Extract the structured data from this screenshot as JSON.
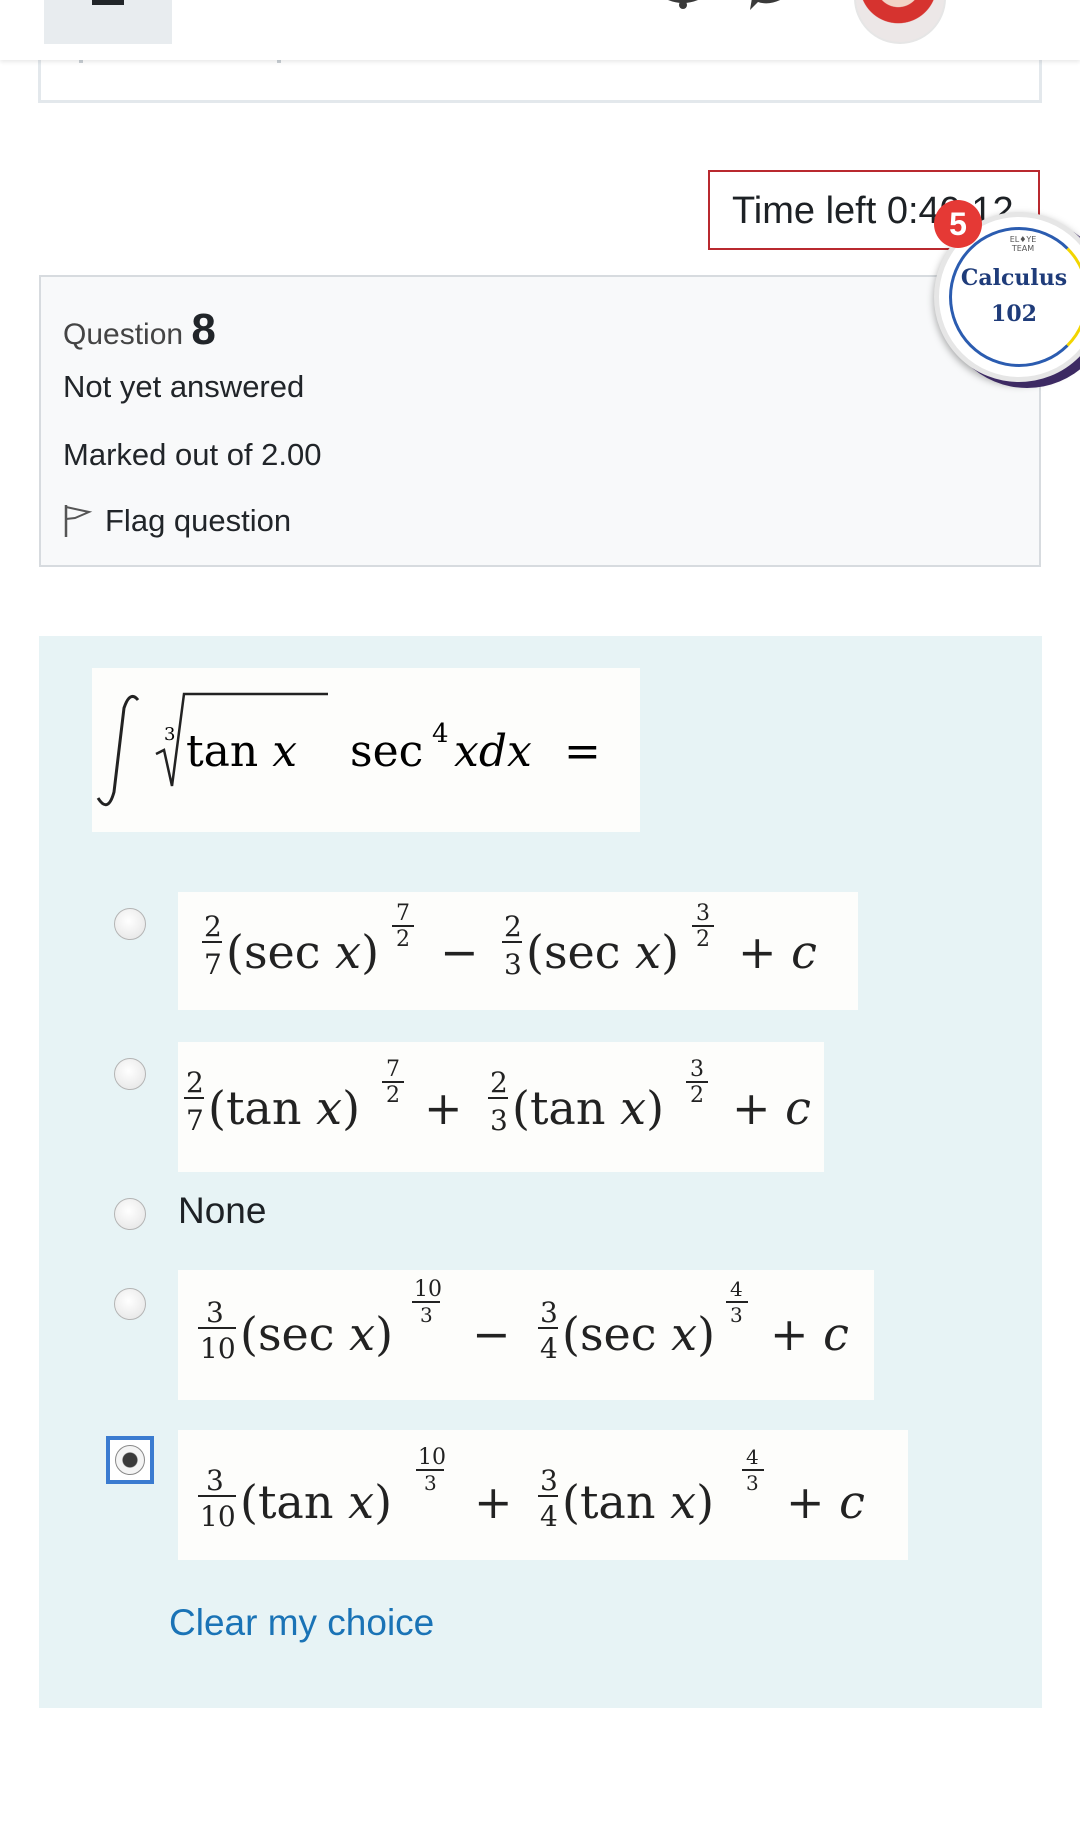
{
  "timer": {
    "text": "Time left 0:40:12"
  },
  "notification": {
    "count": "5"
  },
  "badge": {
    "small_text": "EL♦YE TEAM",
    "title": "Calculus",
    "number": "102"
  },
  "question": {
    "label": "Question",
    "number": "8",
    "status": "Not yet answered",
    "marks": "Marked out of 2.00",
    "flag_label": "Flag question"
  },
  "answers": {
    "none_label": "None",
    "clear_label": "Clear my choice",
    "selected_index": 4
  },
  "colors": {
    "timer_border": "#b9292f",
    "answer_background": "#e7f3f5",
    "link": "#1a73b6",
    "selected_radio_border": "#3b7bd0",
    "notification": "#e53935"
  }
}
